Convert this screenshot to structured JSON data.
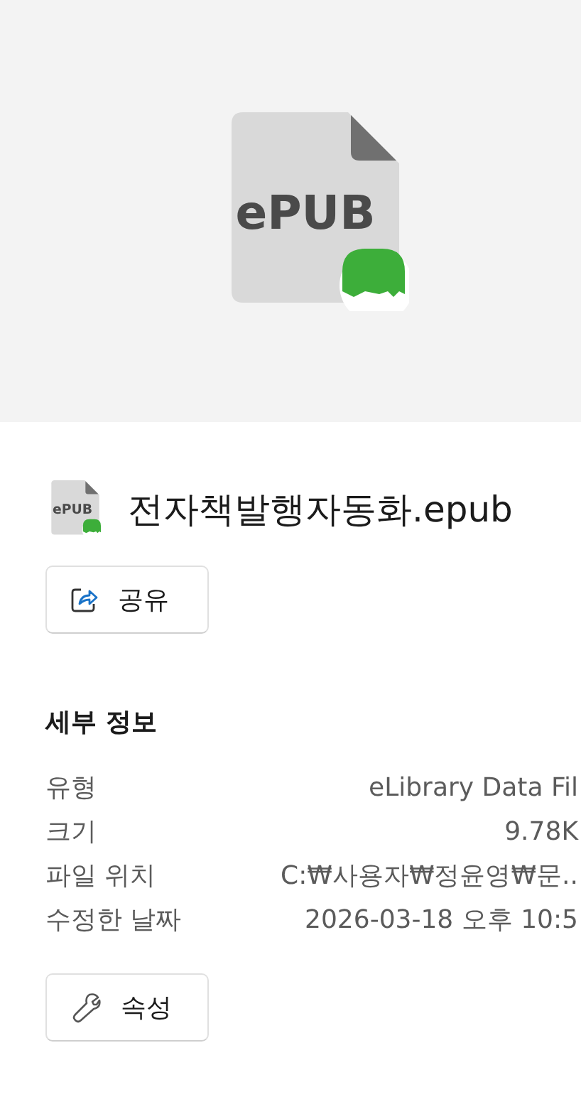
{
  "preview": {
    "icon_label": "ePUB"
  },
  "file": {
    "icon_label": "ePUB",
    "name": "전자책발행자동화.epub"
  },
  "share_button": {
    "label": "공유",
    "kind": "share"
  },
  "details": {
    "title": "세부 정보",
    "rows": [
      {
        "label": "유형",
        "value": "eLibrary Data Fil"
      },
      {
        "label": "크기",
        "value": "9.78K"
      },
      {
        "label": "파일 위치",
        "value": "C:₩사용자₩정윤영₩문.."
      },
      {
        "label": "수정한 날짜",
        "value": "2026-03-18 오후 10:5"
      }
    ]
  },
  "properties_button": {
    "label": "속성",
    "kind": "properties"
  }
}
